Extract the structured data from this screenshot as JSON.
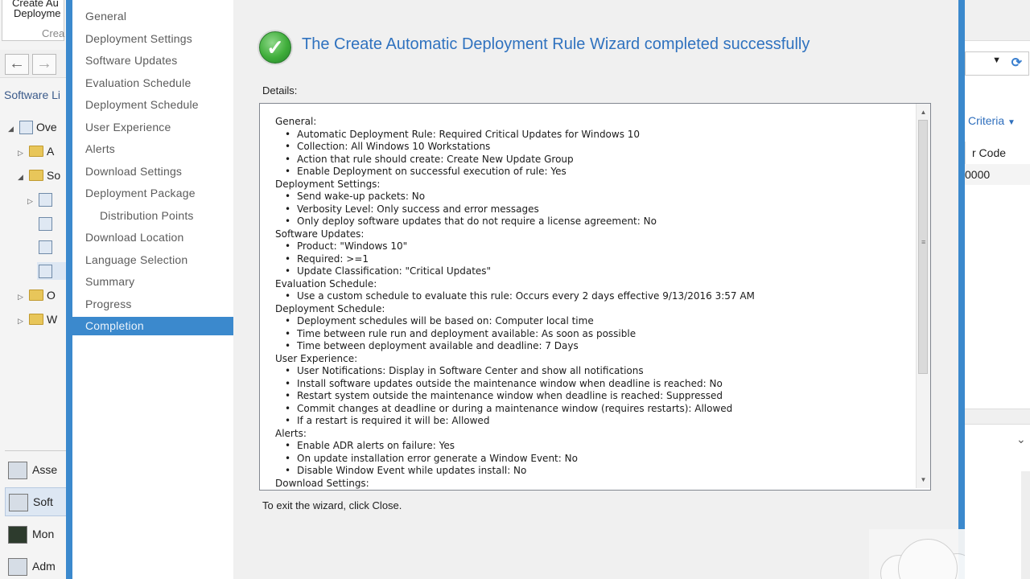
{
  "console": {
    "ribbon_button_lines": [
      "Create Au",
      "Deployme"
    ],
    "ribbon_sub_label": "Crea",
    "workspace_title": "Software Li",
    "tree": [
      {
        "label": "Ove",
        "icon": "overview-icon",
        "twisty": "expanded"
      },
      {
        "label": "A",
        "icon": "folder-icon",
        "twisty": "collapsed"
      },
      {
        "label": "So",
        "icon": "folder-icon",
        "twisty": "expanded"
      },
      {
        "label": "",
        "icon": "update-node-icon",
        "twisty": "collapsed"
      },
      {
        "label": "",
        "icon": "update-node-icon",
        "twisty": ""
      },
      {
        "label": "",
        "icon": "package-node-icon",
        "twisty": ""
      },
      {
        "label": "",
        "icon": "rule-node-icon",
        "twisty": ""
      },
      {
        "label": "O",
        "icon": "folder-icon",
        "twisty": "collapsed"
      },
      {
        "label": "W",
        "icon": "folder-icon",
        "twisty": "collapsed"
      }
    ],
    "workspaces": [
      {
        "label": "Asse",
        "icon": "assets-icon"
      },
      {
        "label": "Soft",
        "icon": "software-library-icon"
      },
      {
        "label": "Mon",
        "icon": "monitoring-icon"
      },
      {
        "label": "Adm",
        "icon": "administration-icon"
      }
    ],
    "right_criteria_label": "Criteria",
    "right_column_header": "r Code",
    "right_cell_value": "0000"
  },
  "wizard": {
    "steps": [
      {
        "label": "General",
        "sub": false,
        "active": false
      },
      {
        "label": "Deployment Settings",
        "sub": false,
        "active": false
      },
      {
        "label": "Software Updates",
        "sub": false,
        "active": false
      },
      {
        "label": "Evaluation Schedule",
        "sub": false,
        "active": false
      },
      {
        "label": "Deployment Schedule",
        "sub": false,
        "active": false
      },
      {
        "label": "User Experience",
        "sub": false,
        "active": false
      },
      {
        "label": "Alerts",
        "sub": false,
        "active": false
      },
      {
        "label": "Download Settings",
        "sub": false,
        "active": false
      },
      {
        "label": "Deployment Package",
        "sub": false,
        "active": false
      },
      {
        "label": "Distribution Points",
        "sub": true,
        "active": false
      },
      {
        "label": "Download Location",
        "sub": false,
        "active": false
      },
      {
        "label": "Language Selection",
        "sub": false,
        "active": false
      },
      {
        "label": "Summary",
        "sub": false,
        "active": false
      },
      {
        "label": "Progress",
        "sub": false,
        "active": false
      },
      {
        "label": "Completion",
        "sub": false,
        "active": true
      }
    ],
    "headline": "The Create Automatic Deployment Rule Wizard completed successfully",
    "details_label": "Details:",
    "details": [
      {
        "kind": "sec",
        "text": "General:"
      },
      {
        "kind": "item",
        "text": "Automatic Deployment Rule: Required Critical Updates for Windows 10"
      },
      {
        "kind": "item",
        "text": "Collection: All Windows 10 Workstations"
      },
      {
        "kind": "item",
        "text": "Action that rule should create: Create New Update Group"
      },
      {
        "kind": "item",
        "text": "Enable Deployment on successful execution of rule: Yes"
      },
      {
        "kind": "sec",
        "text": "Deployment Settings:"
      },
      {
        "kind": "item",
        "text": "Send wake-up packets: No"
      },
      {
        "kind": "item",
        "text": "Verbosity Level: Only success and error messages"
      },
      {
        "kind": "item",
        "text": "Only deploy software updates that do not require a license agreement: No"
      },
      {
        "kind": "sec",
        "text": "Software Updates:"
      },
      {
        "kind": "item",
        "text": "Product: \"Windows 10\""
      },
      {
        "kind": "item",
        "text": "Required: >=1"
      },
      {
        "kind": "item",
        "text": "Update Classification: \"Critical Updates\""
      },
      {
        "kind": "sec",
        "text": "Evaluation Schedule:"
      },
      {
        "kind": "item",
        "text": "Use a custom schedule to evaluate this rule: Occurs every 2 days effective 9/13/2016 3:57 AM"
      },
      {
        "kind": "sec",
        "text": "Deployment Schedule:"
      },
      {
        "kind": "item",
        "text": "Deployment schedules will be based on: Computer local time"
      },
      {
        "kind": "item",
        "text": "Time between rule run and deployment available: As soon as possible"
      },
      {
        "kind": "item",
        "text": "Time between deployment available and deadline: 7 Days"
      },
      {
        "kind": "sec",
        "text": "User Experience:"
      },
      {
        "kind": "item",
        "text": "User Notifications: Display in Software Center and show all notifications"
      },
      {
        "kind": "item",
        "text": "Install software updates outside the maintenance window when deadline is reached: No"
      },
      {
        "kind": "item",
        "text": "Restart system outside the maintenance window when deadline is reached: Suppressed"
      },
      {
        "kind": "item",
        "text": "Commit changes at deadline or during a maintenance window (requires restarts): Allowed"
      },
      {
        "kind": "item",
        "text": "If a restart is required it will be: Allowed"
      },
      {
        "kind": "sec",
        "text": "Alerts:"
      },
      {
        "kind": "item",
        "text": "Enable ADR alerts on failure: Yes"
      },
      {
        "kind": "item",
        "text": "On update installation error generate a Window Event: No"
      },
      {
        "kind": "item",
        "text": "Disable Window Event while updates install: No"
      },
      {
        "kind": "sec",
        "text": "Download Settings:"
      }
    ],
    "exit_text": "To exit the wizard, click Close."
  },
  "colors": {
    "accent": "#3b89cd",
    "headline": "#2f72bf",
    "success": "#3fae3a"
  }
}
